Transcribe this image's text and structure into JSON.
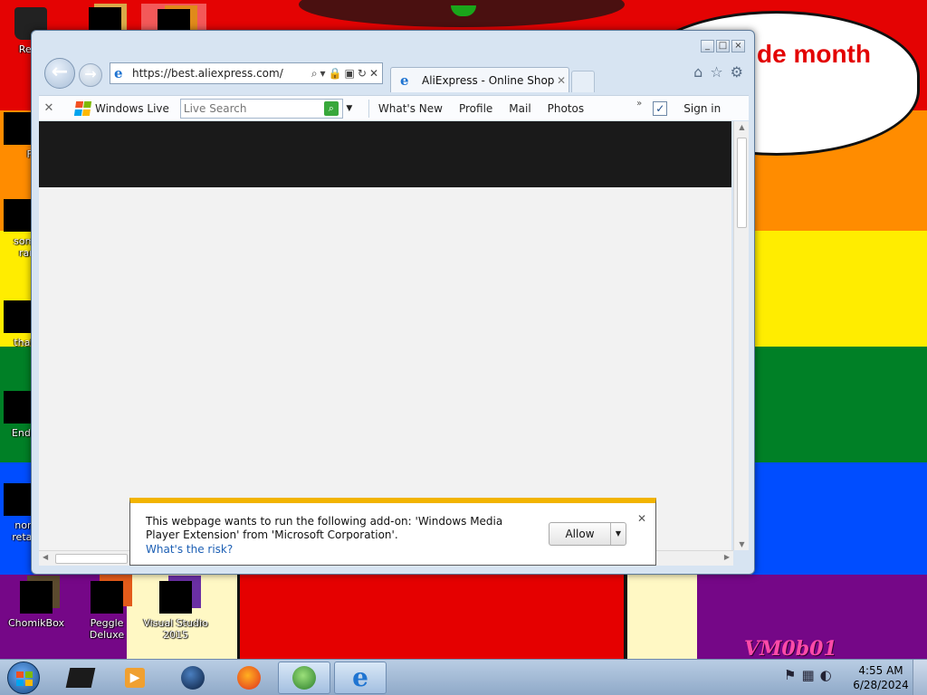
{
  "wallpaper": {
    "bubble_text": "de month",
    "bubble_extra": "!",
    "watermark": "VM0b01"
  },
  "desktop_icons": [
    {
      "label": "Recy"
    },
    {
      "label": "Fir"
    },
    {
      "label": "some\nran"
    },
    {
      "label": "thatl"
    },
    {
      "label": "Ender"
    },
    {
      "label": "none\nretard"
    },
    {
      "label": "ChomikBox"
    },
    {
      "label": "Peggle Deluxe"
    },
    {
      "label": "Visual Studio\n2015"
    }
  ],
  "browser": {
    "address": {
      "url": "https://best.aliexpress.com/"
    },
    "tab": {
      "title": "AliExpress - Online Shoppi..."
    },
    "links_bar": {
      "windows_live": "Windows Live",
      "search_placeholder": "Live Search",
      "links": [
        "What's New",
        "Profile",
        "Mail",
        "Photos"
      ],
      "sign_in": "Sign in"
    }
  },
  "notification": {
    "message": "This webpage wants to run the following add-on: 'Windows Media Player Extension' from 'Microsoft Corporation'.",
    "risk_link": "What's the risk?",
    "allow_label": "Allow"
  },
  "taskbar": {
    "time": "4:55 AM",
    "date": "6/28/2024"
  },
  "colors": {
    "notification_accent": "#f2b400",
    "link": "#1c5fb4",
    "search_go": "#39a83b"
  }
}
